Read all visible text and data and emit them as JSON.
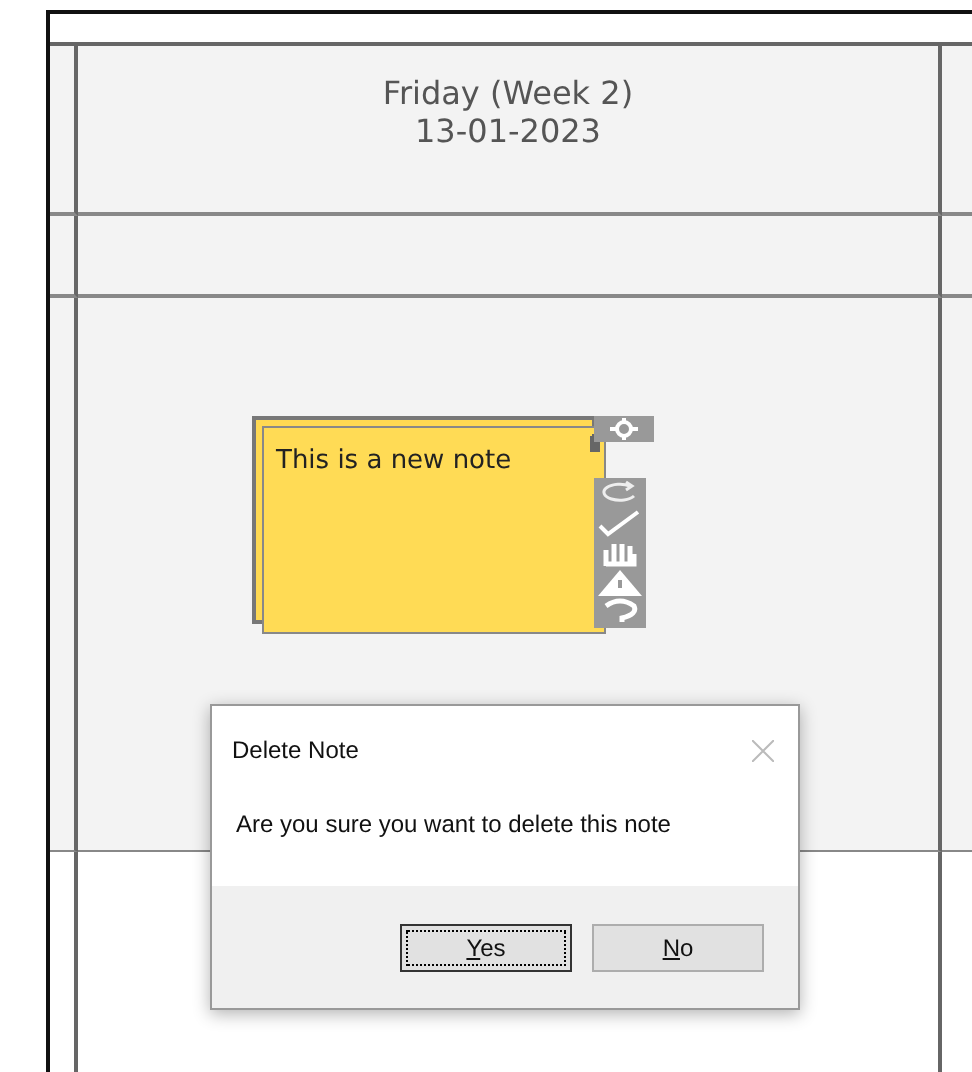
{
  "day_header": {
    "day": "Friday (Week 2)",
    "date": "13-01-2023"
  },
  "note": {
    "text": "This is a new note"
  },
  "dialog": {
    "title": "Delete Note",
    "message": "Are you sure you want to delete this note",
    "buttons": [
      {
        "label": "Yes",
        "focused": true
      },
      {
        "label": "No",
        "focused": false
      }
    ]
  }
}
